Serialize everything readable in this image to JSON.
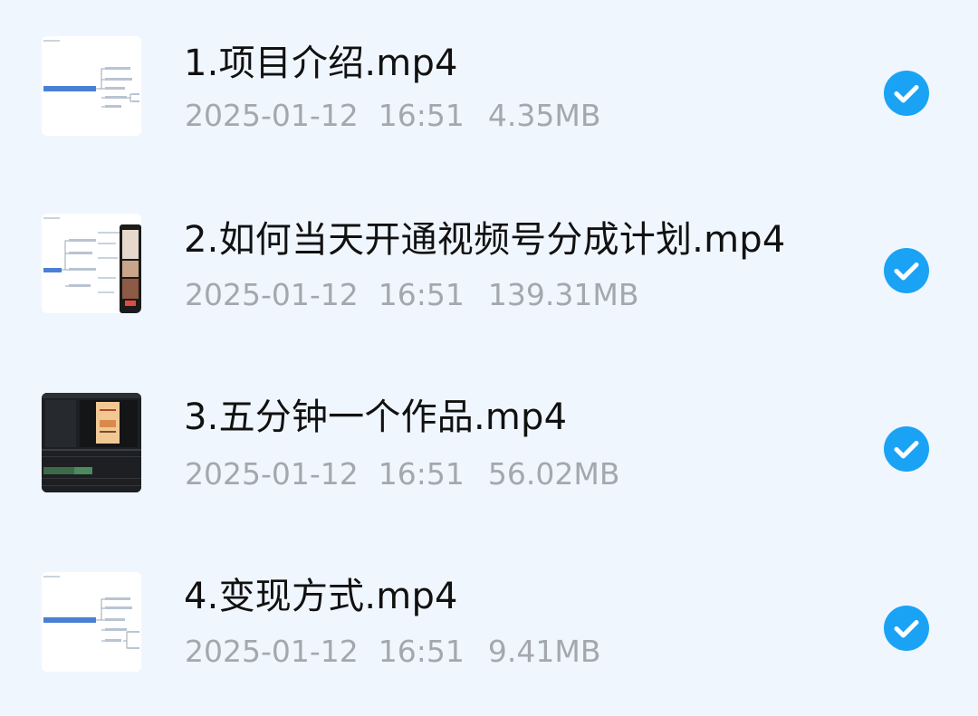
{
  "files": [
    {
      "name": "1.项目介绍.mp4",
      "date": "2025-01-12",
      "time": "16:51",
      "size": "4.35MB",
      "selected": true,
      "thumbnail": "mindmap"
    },
    {
      "name": "2.如何当天开通视频号分成计划.mp4",
      "date": "2025-01-12",
      "time": "16:51",
      "size": "139.31MB",
      "selected": true,
      "thumbnail": "mindmap-with-phone"
    },
    {
      "name": "3.五分钟一个作品.mp4",
      "date": "2025-01-12",
      "time": "16:51",
      "size": "56.02MB",
      "selected": true,
      "thumbnail": "video-editor"
    },
    {
      "name": "4.变现方式.mp4",
      "date": "2025-01-12",
      "time": "16:51",
      "size": "9.41MB",
      "selected": true,
      "thumbnail": "mindmap"
    }
  ],
  "icons": {
    "check": "check-circle-icon"
  },
  "colors": {
    "background": "#f0f6fd",
    "accent": "#1aa3f5",
    "meta_text": "#a4a8ae"
  }
}
